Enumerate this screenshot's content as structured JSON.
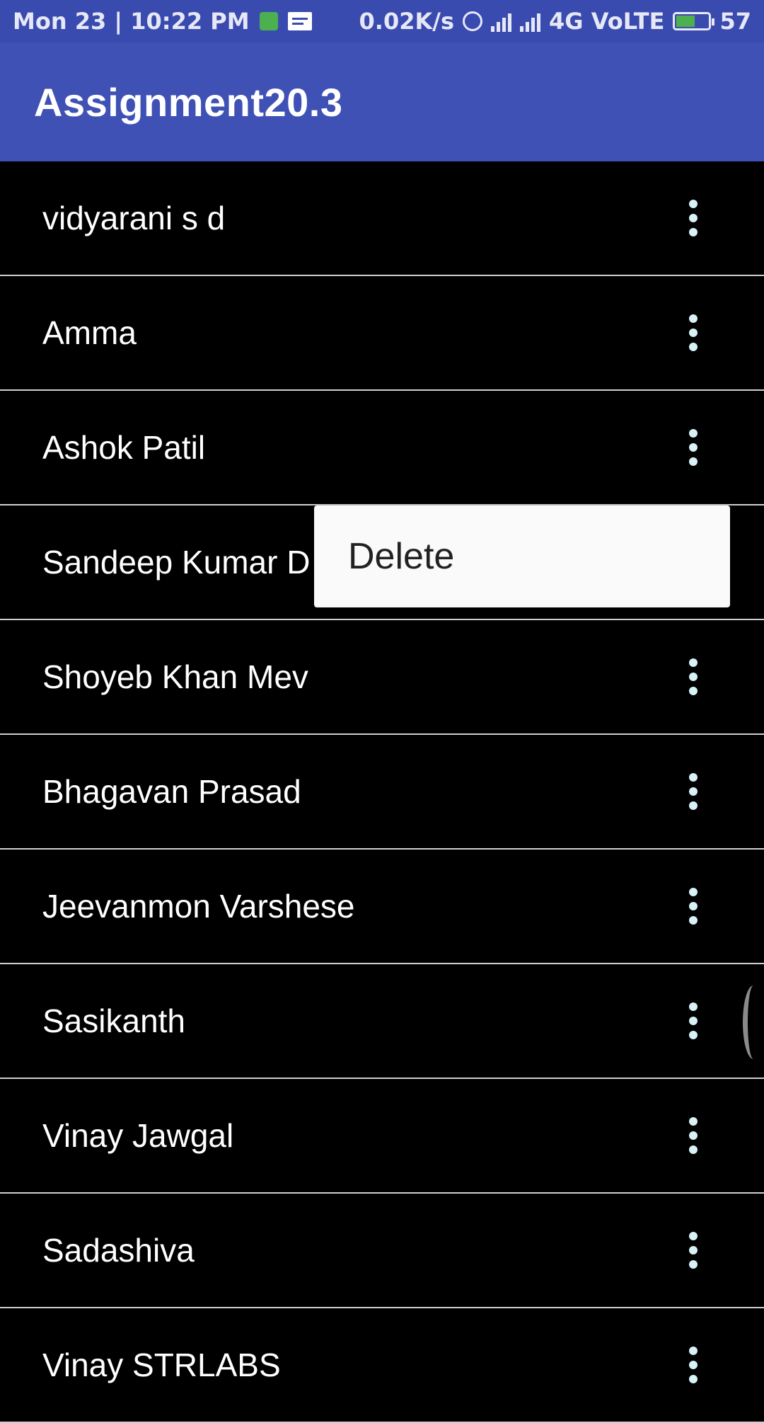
{
  "status_bar": {
    "datetime": "Mon 23 | 10:22 PM",
    "net_speed": "0.02K/s",
    "network": "4G VoLTE",
    "battery": "57"
  },
  "app_bar": {
    "title": "Assignment20.3"
  },
  "contacts": [
    "vidyarani s d",
    "Amma",
    "Ashok Patil",
    "Sandeep Kumar D",
    "Shoyeb Khan Mev",
    "Bhagavan Prasad",
    "Jeevanmon Varshese",
    "Sasikanth",
    "Vinay Jawgal",
    "Sadashiva",
    "Vinay STRLABS"
  ],
  "popup_menu": {
    "items": [
      "Delete"
    ]
  },
  "colors": {
    "app_bar": "#3f51b5",
    "status_bar": "#3a4bb0",
    "list_bg": "#000000"
  },
  "icons": [
    "alarm-icon",
    "signal-icon",
    "battery-icon",
    "overflow-menu-icon"
  ]
}
